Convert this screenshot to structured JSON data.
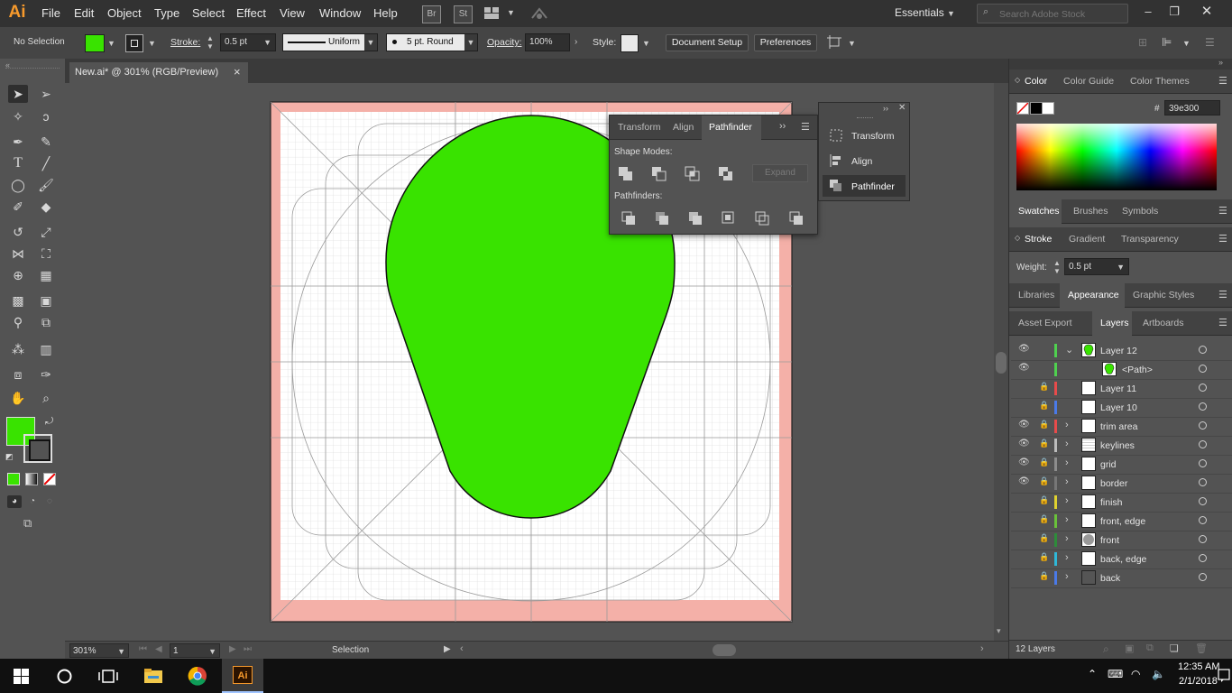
{
  "app": {
    "logo": "Ai",
    "accent": "#f79a2c"
  },
  "menu": [
    "File",
    "Edit",
    "Object",
    "Type",
    "Select",
    "Effect",
    "View",
    "Window",
    "Help"
  ],
  "bridge_buttons": [
    "Br",
    "St"
  ],
  "workspace": "Essentials",
  "search": {
    "placeholder": "Search Adobe Stock"
  },
  "control": {
    "selection_state": "No Selection",
    "fill_color": "#39e300",
    "stroke_label": "Stroke:",
    "stroke_weight": "0.5 pt",
    "profile": "Uniform",
    "brush": "5 pt. Round",
    "opacity_label": "Opacity:",
    "opacity": "100%",
    "style_label": "Style:",
    "document_setup": "Document Setup",
    "preferences": "Preferences"
  },
  "document": {
    "tab_title": "New.ai* @ 301% (RGB/Preview)",
    "close": "×"
  },
  "pathfinder": {
    "tabs": [
      "Transform",
      "Align",
      "Pathfinder"
    ],
    "active_tab": "Pathfinder",
    "shape_modes_label": "Shape Modes:",
    "expand_label": "Expand",
    "pathfinders_label": "Pathfinders:"
  },
  "dock": {
    "items": [
      "Transform",
      "Align",
      "Pathfinder"
    ]
  },
  "color_panel": {
    "tabs": [
      "Color",
      "Color Guide",
      "Color Themes"
    ],
    "hex_label": "#",
    "hex_value": "39e300"
  },
  "swatches_tabs": [
    "Swatches",
    "Brushes",
    "Symbols"
  ],
  "stroke_panel": {
    "tabs": [
      "Stroke",
      "Gradient",
      "Transparency"
    ],
    "weight_label": "Weight:",
    "weight_value": "0.5 pt"
  },
  "appearance_tabs": [
    "Libraries",
    "Appearance",
    "Graphic Styles"
  ],
  "layers_tabs": [
    "Asset Export",
    "Layers",
    "Artboards"
  ],
  "layers": [
    {
      "name": "Layer 12",
      "color": "#4fd14f",
      "visible": true,
      "locked": false,
      "expanded": true,
      "thumb": "green"
    },
    {
      "name": "<Path>",
      "color": "#4fd14f",
      "visible": true,
      "locked": false,
      "sub": true,
      "thumb": "green"
    },
    {
      "name": "Layer 11",
      "color": "#e84b4b",
      "visible": false,
      "locked": true
    },
    {
      "name": "Layer 10",
      "color": "#4a7ae8",
      "visible": false,
      "locked": true
    },
    {
      "name": "trim area",
      "color": "#e84b4b",
      "visible": true,
      "locked": true,
      "arrow": true
    },
    {
      "name": "keylines",
      "color": "#bcbcbc",
      "visible": true,
      "locked": true,
      "arrow": true,
      "thumb": "grid"
    },
    {
      "name": "grid",
      "color": "#8d8d8d",
      "visible": true,
      "locked": true,
      "arrow": true
    },
    {
      "name": "border",
      "color": "#777777",
      "visible": true,
      "locked": true,
      "arrow": true
    },
    {
      "name": "finish",
      "color": "#e0d22f",
      "visible": false,
      "locked": true,
      "arrow": true
    },
    {
      "name": "front, edge",
      "color": "#6ac23a",
      "visible": false,
      "locked": true,
      "arrow": true
    },
    {
      "name": "front",
      "color": "#2e8c3a",
      "visible": false,
      "locked": true,
      "arrow": true,
      "thumb": "circle"
    },
    {
      "name": "back, edge",
      "color": "#2fb8d8",
      "visible": false,
      "locked": true,
      "arrow": true
    },
    {
      "name": "back",
      "color": "#4a7ae8",
      "visible": false,
      "locked": true,
      "arrow": true,
      "thumb": "dark"
    }
  ],
  "layers_count": "12 Layers",
  "status": {
    "zoom": "301%",
    "artboard": "1",
    "tool": "Selection"
  },
  "taskbar": {
    "time": "12:35 AM",
    "date": "2/1/2018"
  }
}
